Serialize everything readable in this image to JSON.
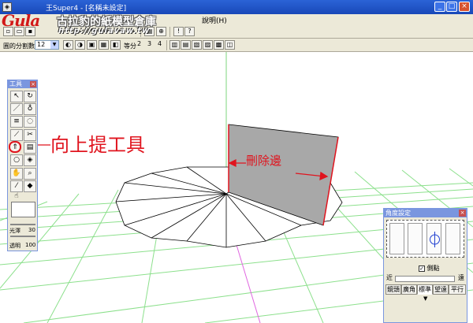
{
  "window": {
    "app_icon": "app-icon",
    "title": "王Super4 - [名稱未設定]",
    "controls": [
      "minimize-icon",
      "maximize-icon",
      "close-icon"
    ]
  },
  "menu": {
    "items": [
      {
        "label": "說明(H)"
      }
    ]
  },
  "watermark": {
    "logo_text": "Gula",
    "title": "古拉豹的紙模型倉庫",
    "url": "http://gulavaw.tw"
  },
  "toolbar2": {
    "divisions_label": "圓的分割數",
    "divisions_value": "12",
    "equal_label": "等分",
    "equal_options": [
      "2",
      "3",
      "4"
    ]
  },
  "annotations": {
    "lift_tool": "向上提工具",
    "remove_edge": "刪除邊"
  },
  "palette": {
    "title": "工具",
    "gloss_label": "光澤",
    "gloss_value": "30",
    "transparency_label": "透明",
    "transparency_value": "100",
    "tools": [
      "select-arrow-icon",
      "rotate-icon",
      "line-icon",
      "paint-bucket-icon",
      "list-icon",
      "lasso-icon",
      "polyline-icon",
      "cut-icon",
      "lift-up-icon",
      "extrude-icon",
      "circle-icon",
      "cube-icon",
      "hand-icon",
      "zoom-icon",
      "eyedropper-icon",
      "fill-icon",
      "pan-icon"
    ]
  },
  "angle_dialog": {
    "title": "角度設定",
    "checkbox_label": "側點",
    "checkbox_checked": true,
    "near_label": "近",
    "far_label": "遠",
    "buttons": [
      "鏡頭",
      "廣角",
      "標準",
      "望遠",
      "平行"
    ],
    "active_button": "標準"
  },
  "colors": {
    "annotation_red": "#e0141e",
    "grid_green": "#8ce08c",
    "face_gray": "#a8a8a8",
    "titlebar_blue": "#2b63d6"
  }
}
